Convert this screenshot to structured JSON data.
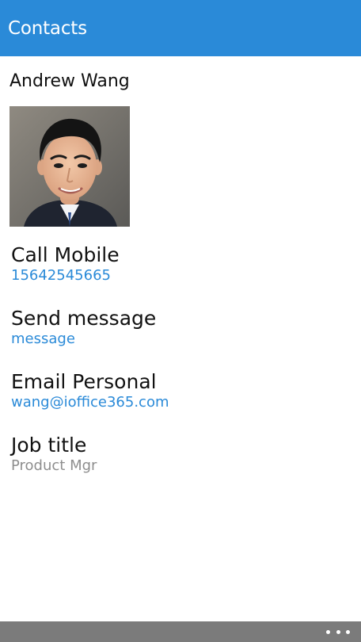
{
  "header": {
    "title": "Contacts"
  },
  "contact": {
    "name": "Andrew Wang",
    "photo_alt": "Andrew Wang",
    "fields": [
      {
        "label": "Call Mobile",
        "value": "15642545665"
      },
      {
        "label": "Send message",
        "value": "message"
      },
      {
        "label": "Email Personal",
        "value": "wang@ioffice365.com"
      },
      {
        "label": "Job title",
        "value": "Product Mgr"
      }
    ]
  },
  "appbar": {
    "more_icon": "ellipsis-icon"
  },
  "colors": {
    "accent": "#2a8ad8",
    "appbar": "#7b7b7b",
    "muted_text": "#8e8e8e"
  }
}
